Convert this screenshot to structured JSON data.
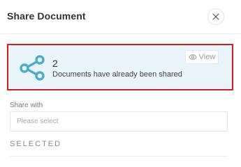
{
  "dialog": {
    "title": "Share Document",
    "close_icon": "close-icon"
  },
  "summary": {
    "count": "2",
    "description": "Documents have already been shared",
    "icon": "share-icon",
    "accent_color": "#4aaec6",
    "highlight_border_color": "#cc1f1f",
    "view_button": {
      "icon": "eye-icon",
      "label": "View"
    }
  },
  "share_with": {
    "label": "Share with",
    "placeholder": "Please select"
  },
  "selected": {
    "heading": "SELECTED"
  }
}
